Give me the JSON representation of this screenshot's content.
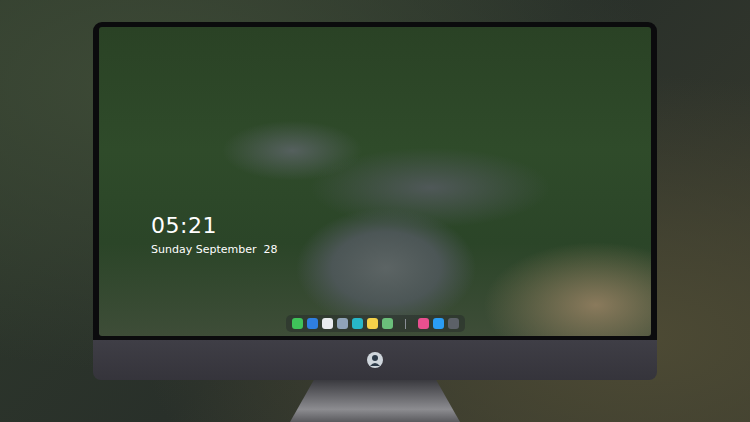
{
  "clock": {
    "time": "05:21",
    "date": "Sunday September  28"
  },
  "dock": {
    "items": [
      {
        "kind": "app",
        "color": "#3fc35a"
      },
      {
        "kind": "app",
        "color": "#2f7fe0"
      },
      {
        "kind": "app",
        "color": "#e9ecef"
      },
      {
        "kind": "app",
        "color": "#8fa3b8"
      },
      {
        "kind": "app",
        "color": "#27b7c9"
      },
      {
        "kind": "app",
        "color": "#f4d24a"
      },
      {
        "kind": "app",
        "color": "#6bbf7a"
      },
      {
        "kind": "separator",
        "color": "#8a8f96"
      },
      {
        "kind": "app",
        "color": "#e8508f"
      },
      {
        "kind": "app",
        "color": "#2a9df4"
      },
      {
        "kind": "app",
        "color": "#5c6168"
      }
    ]
  }
}
